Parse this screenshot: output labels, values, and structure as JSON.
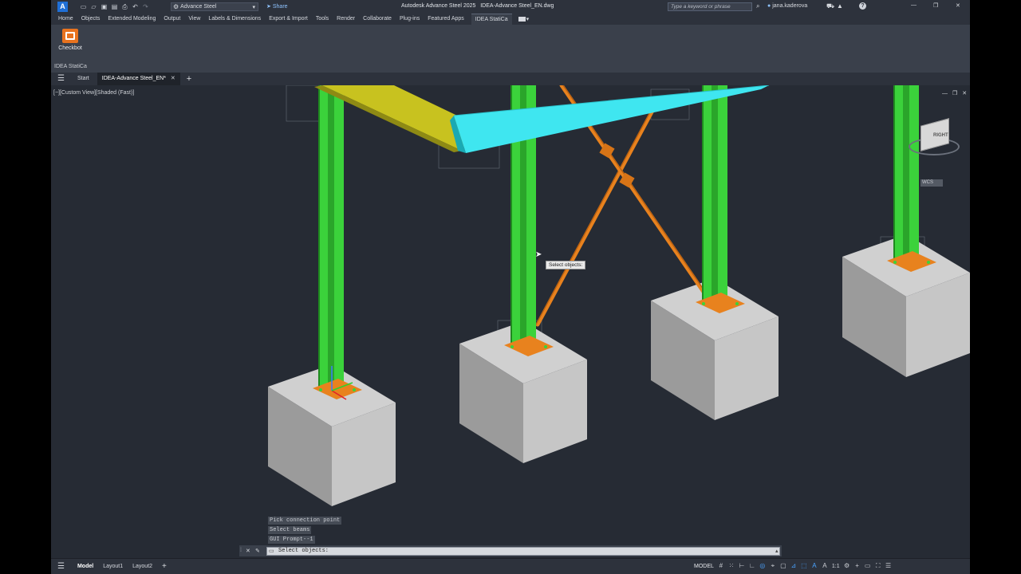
{
  "app": {
    "title": "Autodesk Advance Steel 2025   IDEA-Advance Steel_EN.dwg",
    "logo": "A",
    "workspace": "Advance Steel",
    "share": "Share",
    "search_placeholder": "Type a keyword or phrase",
    "user": "jana.kaderova"
  },
  "ribbon": {
    "tabs": [
      "Home",
      "Objects",
      "Extended Modeling",
      "Output",
      "View",
      "Labels & Dimensions",
      "Export & Import",
      "Tools",
      "Render",
      "Collaborate",
      "Plug-ins",
      "Featured Apps",
      "IDEA StatiCa"
    ],
    "active_tab": "IDEA StatiCa",
    "panel_button": "Checkbot",
    "panel_title": "IDEA StatiCa",
    "tool_icon": "idea-statica-icon",
    "accent": "#e8731f"
  },
  "doc_tabs": {
    "start": "Start",
    "active": "IDEA-Advance Steel_EN*"
  },
  "viewport": {
    "view_label": "[−][Custom View][Shaded (Fast)]",
    "tooltip": "Select objects:",
    "viewcube_label": "RIGHT",
    "wcs_label": "WCS",
    "colors": {
      "column": "#3bd23b",
      "beam_cyan": "#3fe6f0",
      "beam_yellow": "#c8c21f",
      "bracing": "#e8821e",
      "footing": "#bdbdbd"
    }
  },
  "command": {
    "history": [
      "Pick connection point",
      "Select beams",
      "GUI Prompt--1"
    ],
    "prompt": "Select objects:"
  },
  "status": {
    "layout_tabs": [
      "Model",
      "Layout1",
      "Layout2"
    ],
    "active_layout": "Model",
    "model_label": "MODEL",
    "scale": "1:1"
  }
}
